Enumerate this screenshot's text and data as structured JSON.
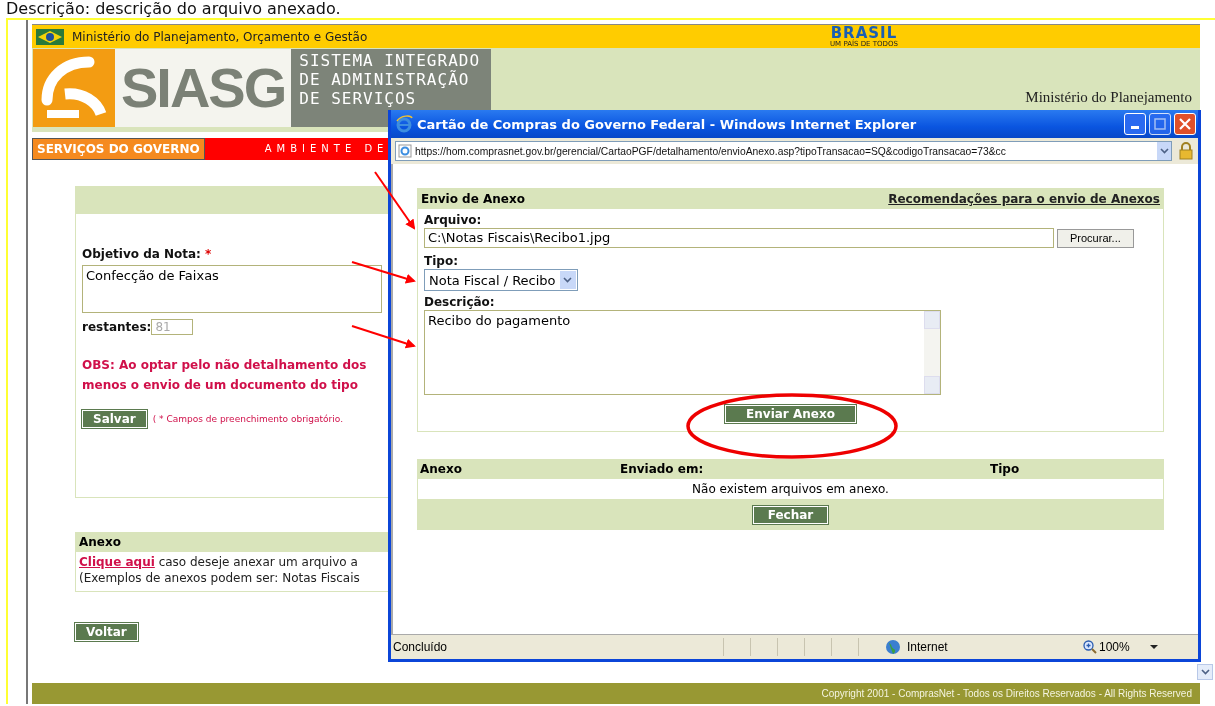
{
  "caption": "Descrição: descrição do arquivo anexado.",
  "gov_bar": {
    "ministry": "Ministério do Planejamento, Orçamento e Gestão",
    "logo_text": "BRASIL",
    "logo_tagline": "UM PAÍS DE TODOS"
  },
  "header": {
    "logo_text": "SIASG",
    "system_lines": [
      "SISTEMA INTEGRADO",
      "DE ADMINISTRAÇÃO",
      "DE SERVIÇOS"
    ],
    "ministry": "Ministério do Planejamento"
  },
  "nav": {
    "section": "SERVIÇOS DO GOVERNO",
    "environment": "AMBIENTE DE"
  },
  "form": {
    "field_label": "Objetivo da Nota:",
    "required_mark": "*",
    "field_value": "Confecção de Faixas",
    "remaining_label": "restantes:",
    "remaining_value": "81",
    "notice_lines": [
      "OBS: Ao optar pelo não detalhamento dos",
      "menos o envio de um documento do tipo"
    ],
    "save_button": "Salvar",
    "required_note": "( * Campos de preenchimento obrigatório."
  },
  "attachment": {
    "title": "Anexo",
    "link": "Clique aqui",
    "text": "caso deseje anexar um arquivo a",
    "examples": "(Exemplos de anexos podem ser: Notas Fiscais"
  },
  "back_button": "Voltar",
  "footer": "Copyright 2001 - ComprasNet - Todos os Direitos Reservados - All Rights Reserved",
  "popup": {
    "title": "Cartão de Compras do Governo Federal - Windows Internet Explorer",
    "url": "https://hom.comprasnet.gov.br/gerencial/CartaoPGF/detalhamento/envioAnexo.asp?tipoTransacao=SQ&codigoTransacao=73&cc",
    "upload": {
      "title": "Envio de Anexo",
      "help_link": "Recomendações para o envio de Anexos",
      "fields": [
        {
          "kind": "file",
          "label": "Arquivo:",
          "value": "C:\\Notas Fiscais\\Recibo1.jpg",
          "button": "Procurar..."
        },
        {
          "kind": "select",
          "label": "Tipo:",
          "value": "Nota Fiscal / Recibo"
        },
        {
          "kind": "textarea",
          "label": "Descrição:",
          "value": "Recibo do pagamento"
        }
      ],
      "submit": "Enviar Anexo"
    },
    "table": {
      "columns": [
        "Anexo",
        "Enviado em:",
        "Tipo"
      ],
      "empty": "Não existem arquivos em anexo.",
      "close_button": "Fechar"
    },
    "status": {
      "text": "Concluído",
      "zone": "Internet",
      "zoom": "100%"
    }
  }
}
